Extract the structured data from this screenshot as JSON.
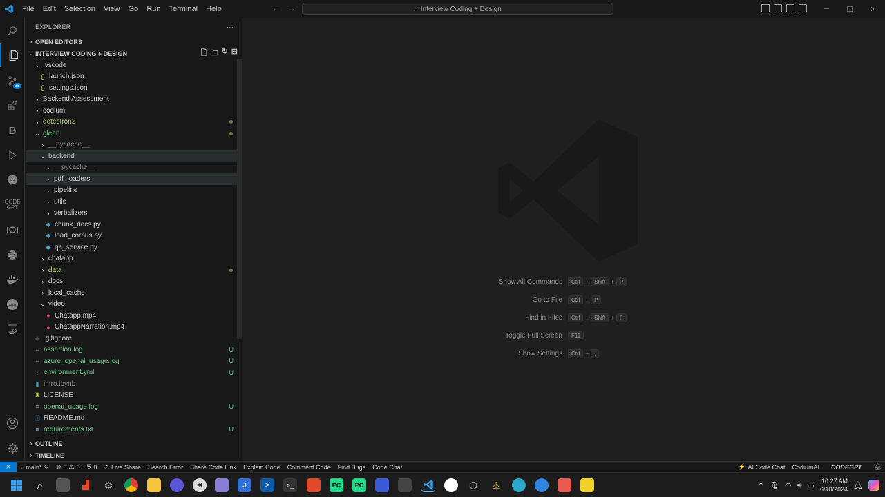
{
  "titlebar": {
    "menu": [
      "File",
      "Edit",
      "Selection",
      "View",
      "Go",
      "Run",
      "Terminal",
      "Help"
    ],
    "search": "Interview Coding + Design",
    "search_icon": "search-icon"
  },
  "activity": {
    "source_control_badge": "38"
  },
  "sidebar": {
    "header": "EXPLORER",
    "more": "···",
    "open_editors": "OPEN EDITORS",
    "workspace": "INTERVIEW CODING + DESIGN",
    "outline": "OUTLINE",
    "timeline": "TIMELINE"
  },
  "tree": [
    {
      "label": ".vscode",
      "indent": 1,
      "kind": "folder-open",
      "color": "white"
    },
    {
      "label": "launch.json",
      "indent": 2,
      "kind": "json",
      "color": "white"
    },
    {
      "label": "settings.json",
      "indent": 2,
      "kind": "json",
      "color": "white"
    },
    {
      "label": "Backend Assessment",
      "indent": 1,
      "kind": "folder",
      "color": "white"
    },
    {
      "label": "codium",
      "indent": 1,
      "kind": "folder",
      "color": "white"
    },
    {
      "label": "detectron2",
      "indent": 1,
      "kind": "folder",
      "color": "mod",
      "dot": true
    },
    {
      "label": "gleen",
      "indent": 1,
      "kind": "folder-open",
      "color": "green",
      "dot": true
    },
    {
      "label": "__pycache__",
      "indent": 2,
      "kind": "folder",
      "color": "dim"
    },
    {
      "label": "backend",
      "indent": 2,
      "kind": "folder-open",
      "color": "white",
      "selected": true
    },
    {
      "label": "__pycache__",
      "indent": 3,
      "kind": "folder",
      "color": "dim"
    },
    {
      "label": "pdf_loaders",
      "indent": 3,
      "kind": "folder",
      "color": "white",
      "selected": true
    },
    {
      "label": "pipeline",
      "indent": 3,
      "kind": "folder",
      "color": "white"
    },
    {
      "label": "utils",
      "indent": 3,
      "kind": "folder",
      "color": "white"
    },
    {
      "label": "verbalizers",
      "indent": 3,
      "kind": "folder",
      "color": "white"
    },
    {
      "label": "chunk_docs.py",
      "indent": 3,
      "kind": "py",
      "color": "white"
    },
    {
      "label": "load_corpus.py",
      "indent": 3,
      "kind": "py",
      "color": "white"
    },
    {
      "label": "qa_service.py",
      "indent": 3,
      "kind": "py",
      "color": "white"
    },
    {
      "label": "chatapp",
      "indent": 2,
      "kind": "folder",
      "color": "white"
    },
    {
      "label": "data",
      "indent": 2,
      "kind": "folder",
      "color": "mod",
      "dot": true
    },
    {
      "label": "docs",
      "indent": 2,
      "kind": "folder",
      "color": "white"
    },
    {
      "label": "local_cache",
      "indent": 2,
      "kind": "folder",
      "color": "white"
    },
    {
      "label": "video",
      "indent": 2,
      "kind": "folder-open",
      "color": "white"
    },
    {
      "label": "Chatapp.mp4",
      "indent": 3,
      "kind": "video",
      "color": "white"
    },
    {
      "label": "ChatappNarration.mp4",
      "indent": 3,
      "kind": "video",
      "color": "white"
    },
    {
      "label": ".gitignore",
      "indent": 1,
      "kind": "git",
      "color": "white"
    },
    {
      "label": "assertion.log",
      "indent": 1,
      "kind": "log",
      "color": "green",
      "status": "U"
    },
    {
      "label": "azure_openai_usage.log",
      "indent": 1,
      "kind": "log",
      "color": "green",
      "status": "U"
    },
    {
      "label": "environment.yml",
      "indent": 1,
      "kind": "yml",
      "color": "green",
      "status": "U"
    },
    {
      "label": "intro.ipynb",
      "indent": 1,
      "kind": "nb",
      "color": "dim"
    },
    {
      "label": "LICENSE",
      "indent": 1,
      "kind": "license",
      "color": "white"
    },
    {
      "label": "openai_usage.log",
      "indent": 1,
      "kind": "log",
      "color": "green",
      "status": "U"
    },
    {
      "label": "README.md",
      "indent": 1,
      "kind": "info",
      "color": "white"
    },
    {
      "label": "requirements.txt",
      "indent": 1,
      "kind": "log",
      "color": "green",
      "status": "U"
    }
  ],
  "shortcuts": [
    {
      "label": "Show All Commands",
      "keys": [
        "Ctrl",
        "Shift",
        "P"
      ]
    },
    {
      "label": "Go to File",
      "keys": [
        "Ctrl",
        "P"
      ]
    },
    {
      "label": "Find in Files",
      "keys": [
        "Ctrl",
        "Shift",
        "F"
      ]
    },
    {
      "label": "Toggle Full Screen",
      "keys": [
        "F11"
      ]
    },
    {
      "label": "Show Settings",
      "keys": [
        "Ctrl",
        ","
      ]
    }
  ],
  "statusbar": {
    "branch": "main*",
    "errors": "0",
    "warnings": "0",
    "ports": "0",
    "live_share": "Live Share",
    "left_items": [
      "Search Error",
      "Share Code Link",
      "Explain Code",
      "Comment Code",
      "Find Bugs",
      "Code Chat"
    ],
    "ai_chat": "AI Code Chat",
    "codium": "CodiumAI",
    "codegpt": "CODEGPT"
  },
  "taskbar": {
    "time": "10:27 AM",
    "date": "6/10/2024"
  }
}
